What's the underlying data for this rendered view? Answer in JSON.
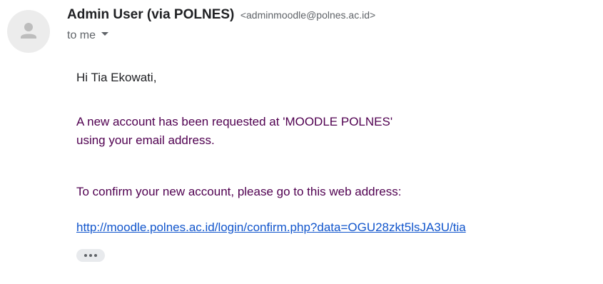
{
  "sender": {
    "name": "Admin User (via POLNES)",
    "email": "<adminmoodle@polnes.ac.id>"
  },
  "recipient": {
    "label": "to me"
  },
  "body": {
    "greeting": "Hi Tia Ekowati,",
    "paragraph1_line1": "A new account has been requested at 'MOODLE POLNES'",
    "paragraph1_line2": "using your email address.",
    "paragraph2": "To confirm your new account, please go to this web address:",
    "link": "http://moodle.polnes.ac.id/login/confirm.php?data=OGU28zkt5lsJA3U/tia"
  },
  "icons": {
    "avatar": "person-icon",
    "recipient_toggle": "caret-down-icon",
    "more": "ellipsis-icon"
  },
  "colors": {
    "link": "#1155cc",
    "quoted_text": "#500050",
    "secondary": "#5f6368"
  }
}
